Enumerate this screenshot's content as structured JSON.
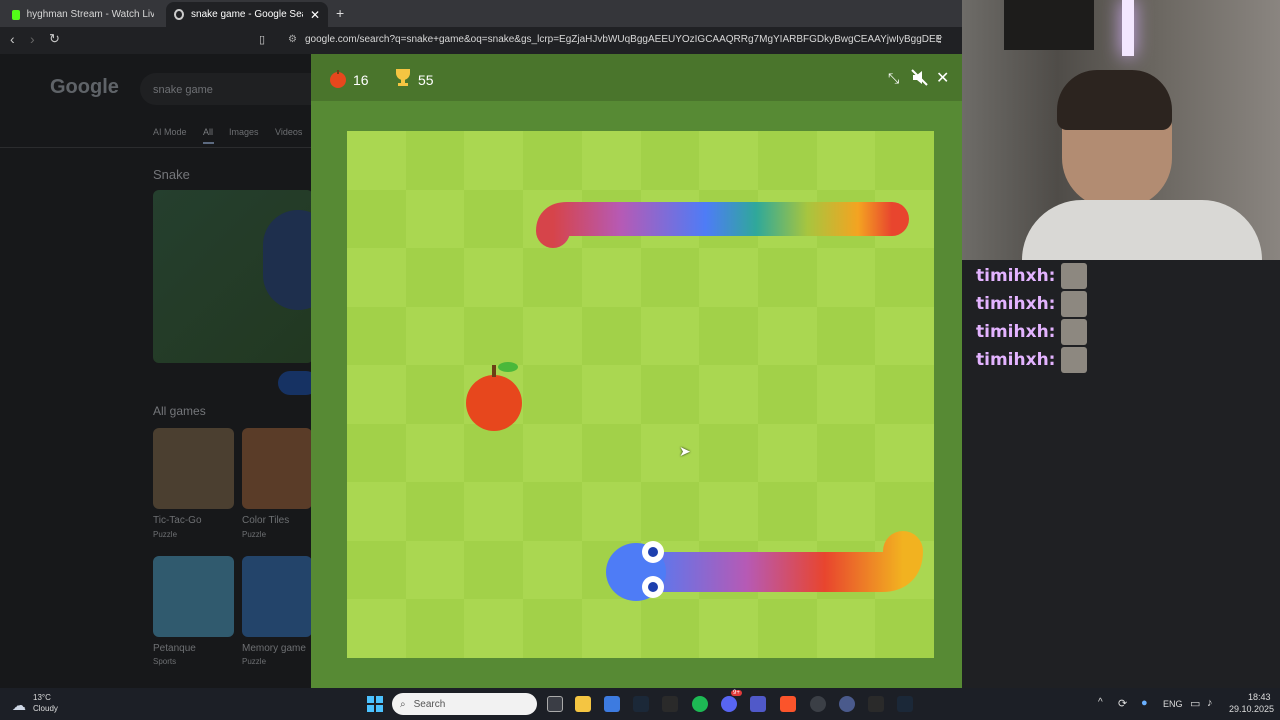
{
  "browser": {
    "tabs": [
      {
        "title": "hyghman Stream - Watch Live on Ki..."
      },
      {
        "title": "snake game - Google Search"
      }
    ],
    "url": "google.com/search?q=snake+game&oq=snake&gs_lcrp=EgZjaHJvbWUqBggAEEUYOzIGCAAQRRg7MgYIARBFGDkyBwgCEAAYjwIyBggDEEUYPDIGCA..."
  },
  "google": {
    "logo": "Google",
    "query": "snake game",
    "tabs": [
      "AI Mode",
      "All",
      "Images",
      "Videos"
    ],
    "panel_title": "Snake",
    "all_games_title": "All games",
    "games": [
      {
        "name": "Tic-Tac-Go",
        "category": "Puzzle"
      },
      {
        "name": "Color Tiles",
        "category": "Puzzle"
      },
      {
        "name": "Petanque",
        "category": "Sports"
      },
      {
        "name": "Memory game",
        "category": "Puzzle"
      }
    ]
  },
  "snake_game": {
    "score": "16",
    "high_score": "55",
    "colors": {
      "light": "#aad751",
      "dark": "#a2d149",
      "frame": "#578a34",
      "header": "#4a752c",
      "apple": "#e7471d",
      "snake": "#4e7cf6"
    }
  },
  "chat": {
    "messages": [
      {
        "user": "timihxh:"
      },
      {
        "user": "timihxh:"
      },
      {
        "user": "timihxh:"
      },
      {
        "user": "timihxh:"
      }
    ]
  },
  "taskbar": {
    "weather_temp": "13°C",
    "weather_desc": "Cloudy",
    "search_placeholder": "Search",
    "language": "ENG",
    "time": "18:43",
    "date": "29.10.2025",
    "discord_badge": "9+"
  }
}
